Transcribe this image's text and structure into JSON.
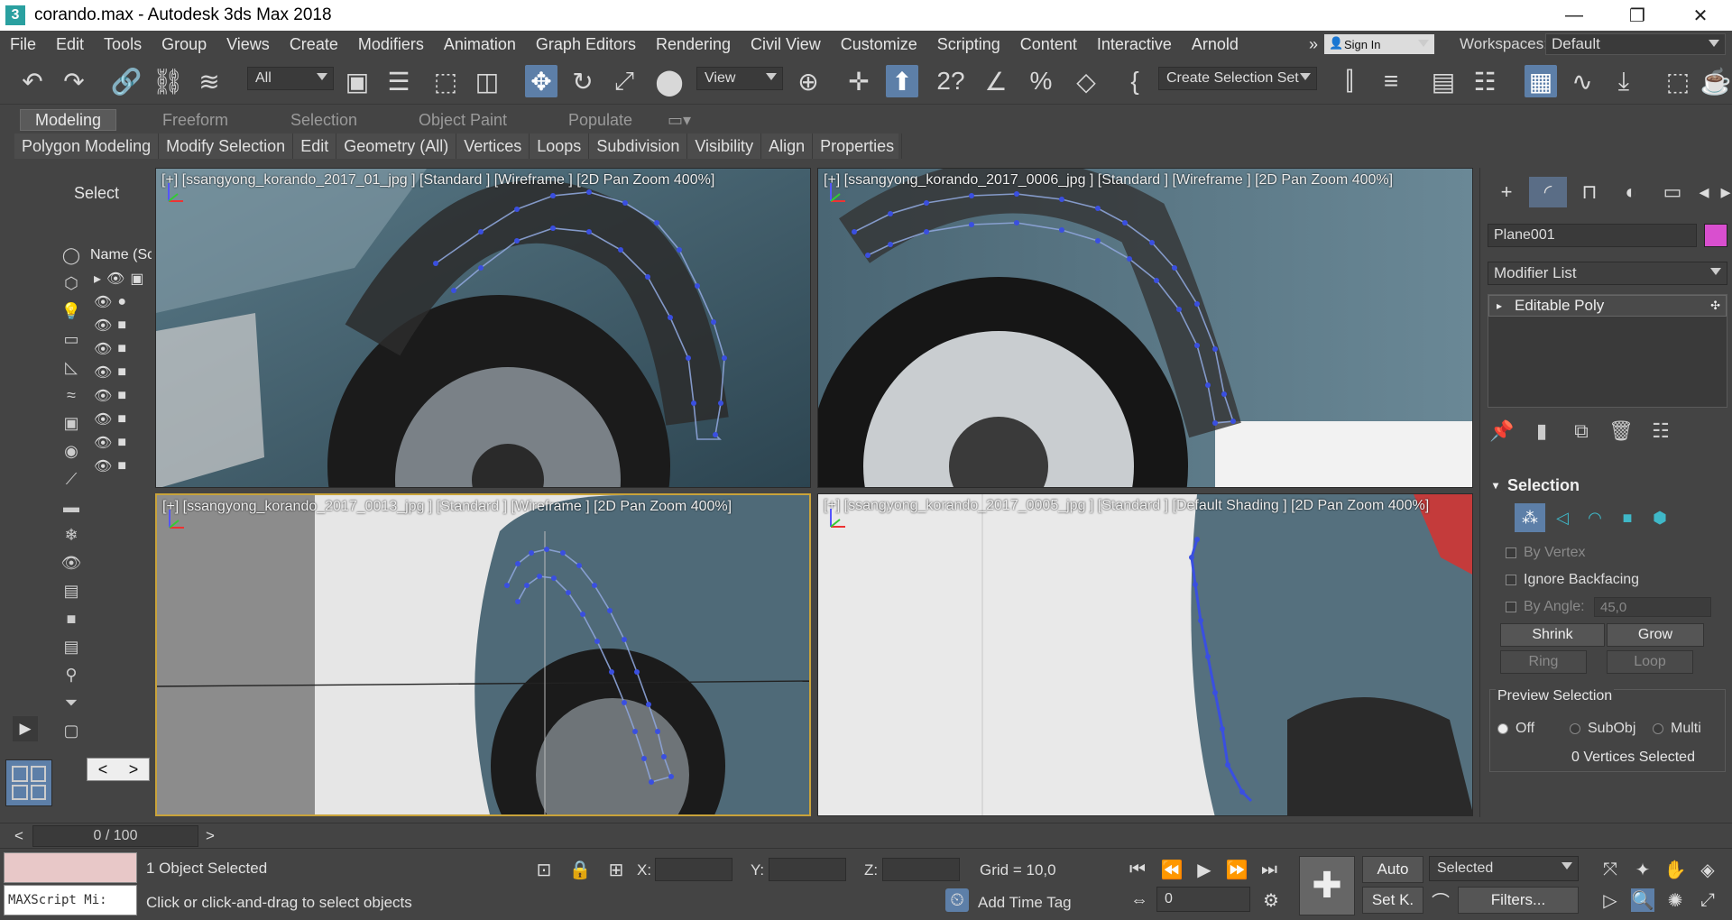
{
  "window": {
    "title": "corando.max - Autodesk 3ds Max 2018",
    "app_icon": "3",
    "minimize": "—",
    "maximize": "❐",
    "close": "✕"
  },
  "menu": {
    "items": [
      "File",
      "Edit",
      "Tools",
      "Group",
      "Views",
      "Create",
      "Modifiers",
      "Animation",
      "Graph Editors",
      "Rendering",
      "Civil View",
      "Customize",
      "Scripting",
      "Content",
      "Interactive",
      "Arnold"
    ],
    "overflow": "»",
    "sign_in": "Sign In",
    "workspaces_label": "Workspaces:",
    "workspace": "Default"
  },
  "toolbar": {
    "selection_filter": "All",
    "ref_coord": "View",
    "named_selection": "Create Selection Set"
  },
  "ribbon": {
    "tabs": [
      "Modeling",
      "Freeform",
      "Selection",
      "Object Paint",
      "Populate"
    ],
    "panels": [
      "Polygon Modeling",
      "Modify Selection",
      "Edit",
      "Geometry (All)",
      "Vertices",
      "Loops",
      "Subdivision",
      "Visibility",
      "Align",
      "Properties"
    ]
  },
  "scene_explorer": {
    "title": "Select",
    "header": "Name (Sc",
    "nav_prev": "<",
    "nav_next": ">"
  },
  "viewports": [
    {
      "label": "[+] [ssangyong_korando_2017_01_jpg ] [Standard ] [Wireframe ] [2D Pan Zoom 400%]"
    },
    {
      "label": "[+] [ssangyong_korando_2017_0006_jpg ] [Standard ] [Wireframe ] [2D Pan Zoom 400%]"
    },
    {
      "label": "[+] [ssangyong_korando_2017_0013_jpg ] [Standard ] [Wireframe ] [2D Pan Zoom 400%]"
    },
    {
      "label": "[+] [ssangyong_korando_2017_0005_jpg ] [Standard ] [Default Shading ] [2D Pan Zoom 400%]"
    }
  ],
  "command_panel": {
    "object_name": "Plane001",
    "object_color": "#d94fcf",
    "modifier_list": "Modifier List",
    "stack_item": "Editable Poly",
    "selection_rollout": "Selection",
    "by_vertex": "By Vertex",
    "ignore_backfacing": "Ignore Backfacing",
    "by_angle": "By Angle:",
    "by_angle_value": "45,0",
    "shrink": "Shrink",
    "grow": "Grow",
    "ring": "Ring",
    "loop": "Loop",
    "preview_selection": "Preview Selection",
    "preview_off": "Off",
    "preview_subobj": "SubObj",
    "preview_multi": "Multi",
    "vertices_selected": "0 Vertices Selected"
  },
  "timeline": {
    "frame": "0 / 100",
    "prev": "<",
    "next": ">"
  },
  "status": {
    "maxscript": "MAXScript Mi:",
    "objects_selected": "1 Object Selected",
    "prompt": "Click or click-and-drag to select objects",
    "x_label": "X:",
    "y_label": "Y:",
    "z_label": "Z:",
    "grid": "Grid = 10,0",
    "add_time_tag": "Add Time Tag",
    "auto": "Auto",
    "set_key": "Set K.",
    "key_filter": "Selected",
    "filters": "Filters...",
    "current_frame": "0"
  },
  "colors": {
    "accent": "#5d7fa8",
    "active_viewport_border": "#c9a33a",
    "mesh_vertex": "#3a4fe0"
  }
}
